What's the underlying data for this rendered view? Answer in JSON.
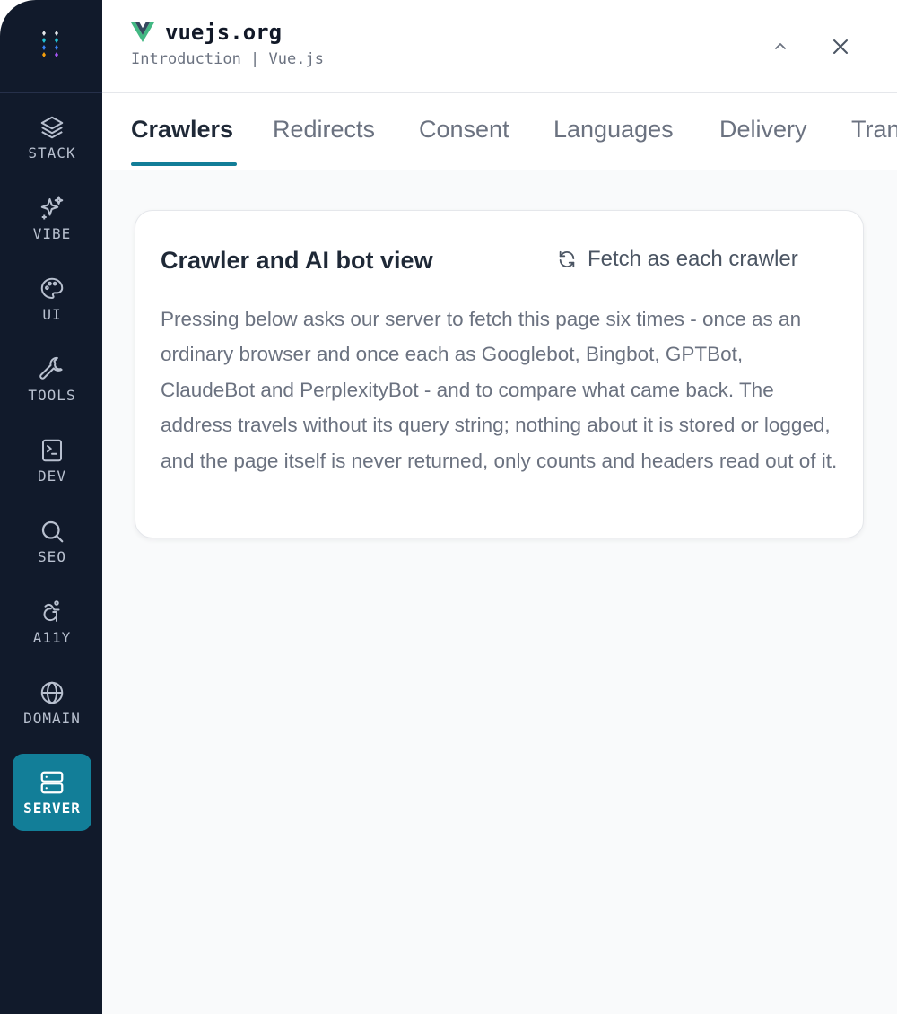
{
  "sidebar": {
    "items": [
      {
        "label": "STACK",
        "icon": "layers-icon"
      },
      {
        "label": "VIBE",
        "icon": "sparkles-icon"
      },
      {
        "label": "UI",
        "icon": "palette-icon"
      },
      {
        "label": "TOOLS",
        "icon": "wrench-icon"
      },
      {
        "label": "DEV",
        "icon": "terminal-icon"
      },
      {
        "label": "SEO",
        "icon": "search-icon"
      },
      {
        "label": "A11Y",
        "icon": "accessibility-icon"
      },
      {
        "label": "DOMAIN",
        "icon": "globe-icon"
      },
      {
        "label": "SERVER",
        "icon": "server-icon",
        "active": true
      }
    ]
  },
  "header": {
    "site_name": "vuejs.org",
    "page_title": "Introduction | Vue.js"
  },
  "tabs": [
    {
      "label": "Crawlers",
      "active": true
    },
    {
      "label": "Redirects"
    },
    {
      "label": "Consent"
    },
    {
      "label": "Languages"
    },
    {
      "label": "Delivery"
    },
    {
      "label": "Tran"
    }
  ],
  "card": {
    "title": "Crawler and AI bot view",
    "action_label": "Fetch as each crawler",
    "body": "Pressing below asks our server to fetch this page six times - once as an ordinary browser and once each as Googlebot, Bingbot, GPTBot, ClaudeBot and PerplexityBot - and to compare what came back. The address travels without its query string; nothing about it is stored or logged, and the page itself is never returned, only counts and headers read out of it."
  },
  "colors": {
    "sidebar_bg": "#111a2b",
    "accent": "#127e98",
    "vue_green": "#42b883",
    "vue_dark": "#35495e"
  }
}
